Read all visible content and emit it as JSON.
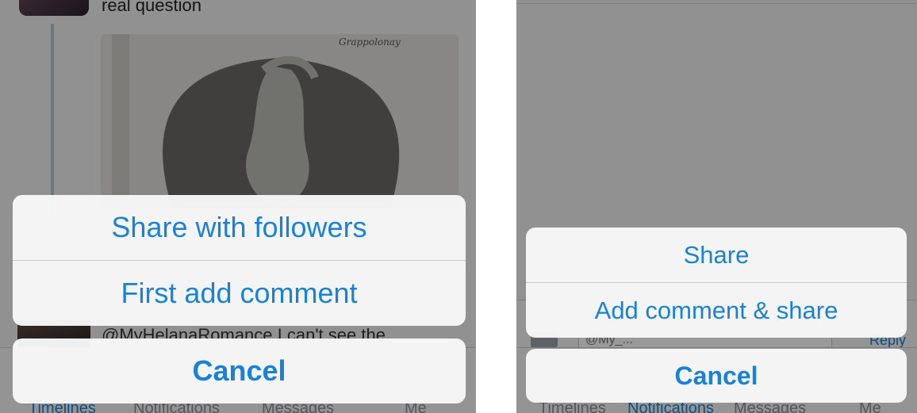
{
  "left": {
    "tweet_text": "real question",
    "reply_text": "@MyHelanaRomance I can't see the",
    "tabs": [
      "Timelines",
      "Notifications",
      "Messages",
      "Me"
    ],
    "active_tab": "Timelines",
    "action_sheet": {
      "option_1": "Share with followers",
      "option_2": "First add comment",
      "cancel": "Cancel"
    }
  },
  "right": {
    "compose_text": "@My_...",
    "reply_link": "Reply",
    "tabs": [
      "Timelines",
      "Notifications",
      "Messages",
      "Me"
    ],
    "active_tab": "Notifications",
    "action_sheet": {
      "option_1": "Share",
      "option_2": "Add comment & share",
      "cancel": "Cancel"
    }
  },
  "colors": {
    "accent": "#1a82d6",
    "sheet_bg": "#f7f7f7",
    "separator": "#c8c8cc"
  }
}
